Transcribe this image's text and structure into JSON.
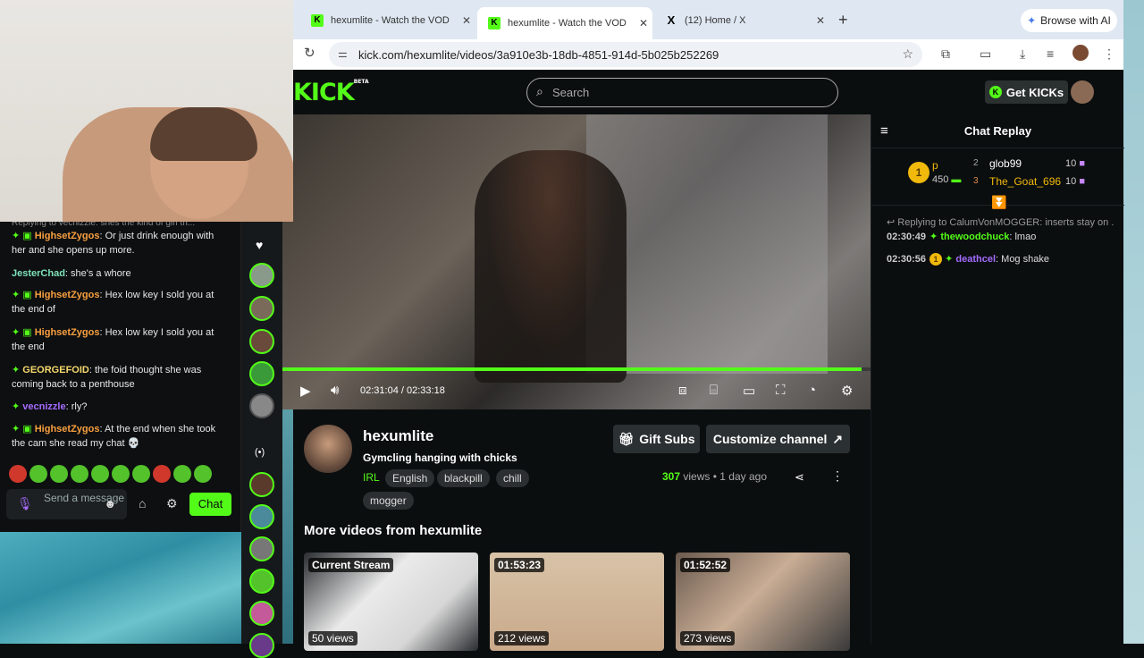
{
  "browser": {
    "tabs": [
      {
        "title": "hexumlite - Watch the VOD o",
        "favicon": "K",
        "active": false
      },
      {
        "title": "hexumlite - Watch the VOD o",
        "favicon": "K",
        "active": true
      },
      {
        "title": "(12) Home / X",
        "favicon": "X",
        "active": false
      }
    ],
    "browse_ai": "Browse with AI",
    "url": "kick.com/hexumlite/videos/3a910e3b-18db-4851-914d-5b025b252269"
  },
  "kick": {
    "logo": "KICK",
    "logo_beta": "BETA",
    "search_placeholder": "Search",
    "get_kicks": "Get KICKs"
  },
  "player": {
    "current_time": "02:31:04",
    "separator": "/",
    "duration": "02:33:18",
    "progress_fraction": 0.985
  },
  "chat_replay": {
    "title": "Chat Replay",
    "leaderboard": {
      "first": {
        "rank": "1",
        "name": "p",
        "amount": "450"
      },
      "others": [
        {
          "rank": "2",
          "name": "glob99",
          "amount": "10"
        },
        {
          "rank": "3",
          "name": "The_Goat_696",
          "amount": "10"
        }
      ]
    },
    "reply_context": "Replying to CalumVonMOGGER: inserts stay on ...",
    "messages": [
      {
        "time": "02:30:49",
        "user": "thewoodchuck",
        "text": "lmao"
      },
      {
        "time": "02:30:56",
        "user": "deathcel",
        "text": "Mog shake"
      }
    ]
  },
  "video_info": {
    "channel": "hexumlite",
    "title": "Gymcling hanging with chicks",
    "category": "IRL",
    "tags": [
      "English",
      "blackpill",
      "chill",
      "mogger"
    ],
    "gift_subs": "Gift Subs",
    "customize": "Customize channel",
    "views_count": "307",
    "views_label": "views",
    "dot": "•",
    "age": "1 day ago"
  },
  "more_videos": {
    "heading": "More videos from hexumlite",
    "items": [
      {
        "badge": "Current Stream",
        "views": "50 views"
      },
      {
        "badge": "01:53:23",
        "views": "212 views"
      },
      {
        "badge": "01:52:52",
        "views": "273 views"
      }
    ]
  },
  "popout_chat": {
    "partial_top": "Replying to vecnizzle: shes the kind of girl th...",
    "messages": [
      {
        "user": "HighsetZygos",
        "color": "#f9a03f",
        "text": ": Or just drink enough with her and she opens up more."
      },
      {
        "user": "JesterChad",
        "color": "#7ee2b8",
        "text": ": she's a whore"
      },
      {
        "user": "HighsetZygos",
        "color": "#f9a03f",
        "text": ": Hex low key I sold you at the end of"
      },
      {
        "user": "HighsetZygos",
        "color": "#f9a03f",
        "text": ": Hex low key I sold you at the end"
      },
      {
        "user": "GEORGEFOID",
        "color": "#f5d86b",
        "text": ": the foid thought she was coming back to a penthouse"
      },
      {
        "user": "vecnizzle",
        "color": "#a46cff",
        "text": ": rly?"
      },
      {
        "user": "HighsetZygos",
        "color": "#f9a03f",
        "text": ": At the end when she took the cam she read my chat 💀"
      }
    ],
    "input_placeholder": "Send a message",
    "chat_button": "Chat"
  }
}
